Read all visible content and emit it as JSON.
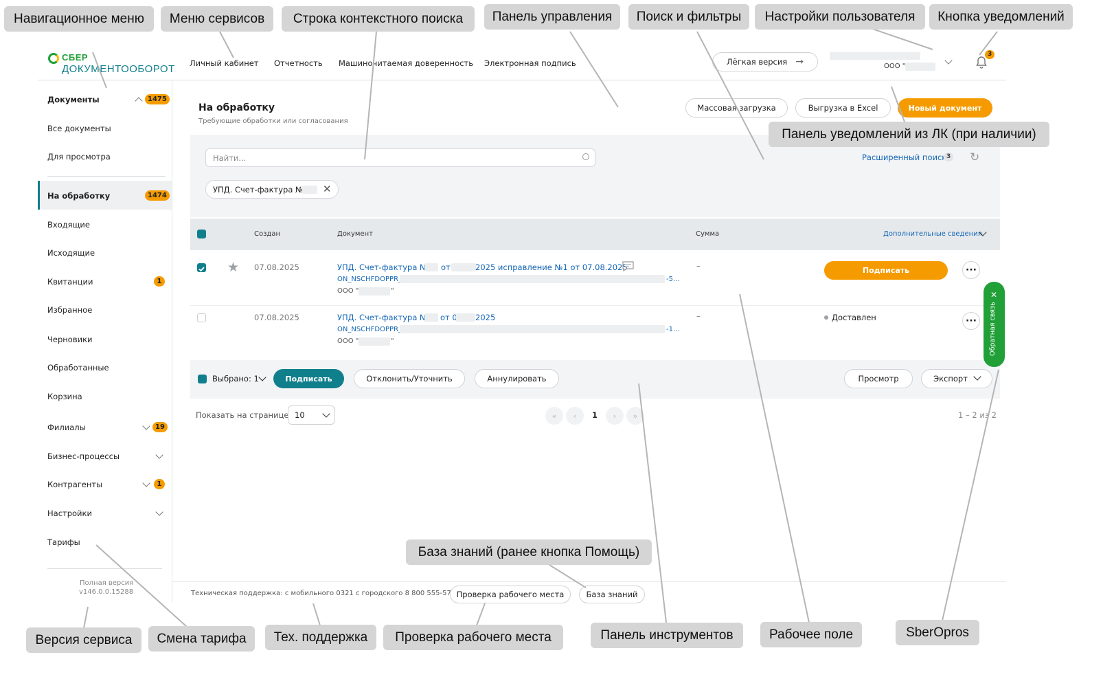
{
  "brand": {
    "line1": "СБЕР",
    "line2": "ДОКУМЕНТООБОРОТ"
  },
  "topnav": {
    "items": [
      "Личный кабинет",
      "Отчетность",
      "Машиночитаемая доверенность",
      "Электронная подпись"
    ],
    "light_version": "Лёгкая версия",
    "org": "ООО \"",
    "bell_count": "3"
  },
  "sidebar": {
    "documents": "Документы",
    "documents_count": "1475",
    "all_docs": "Все документы",
    "for_view": "Для просмотра",
    "in_process": "На обработку",
    "in_process_count": "1474",
    "incoming": "Входящие",
    "outgoing": "Исходящие",
    "receipts": "Квитанции",
    "receipts_count": "1",
    "favorites": "Избранное",
    "drafts": "Черновики",
    "processed": "Обработанные",
    "trash": "Корзина",
    "branches": "Филиалы",
    "branches_count": "19",
    "business": "Бизнес-процессы",
    "contractors": "Контрагенты",
    "contractors_count": "1",
    "settings": "Настройки",
    "tariffs": "Тарифы",
    "version_label": "Полная версия",
    "version": "v146.0.0.15288"
  },
  "main": {
    "title": "На обработку",
    "subtitle": "Требующие обработки или согласования",
    "mass_upload": "Массовая загрузка",
    "excel": "Выгрузка в Excel",
    "new_doc": "Новый документ",
    "search_placeholder": "Найти...",
    "advanced_search": "Расширенный поиск",
    "advanced_count": "3",
    "filter_chip": "УПД. Счет-фактура №",
    "columns": {
      "created": "Создан",
      "document": "Документ",
      "sum": "Сумма",
      "extra": "Дополнительные сведения"
    },
    "rows": [
      {
        "date": "07.08.2025",
        "title_a": "УПД. Счет-фактура №",
        "title_b": "от",
        "title_c": "2025 исправление №1 от 07.08.2025",
        "file_a": "ON_NSCHFDOPPR_",
        "file_b": "-5...",
        "org": "ООО \"",
        "org_end": "\"",
        "sum": "–",
        "action": "Подписать"
      },
      {
        "date": "07.08.2025",
        "title_a": "УПД. Счет-фактура №",
        "title_b": "от 0",
        "title_c": "2025",
        "file_a": "ON_NSCHFDOPPR_",
        "file_b": "-1...",
        "org": "ООО \"",
        "org_end": "\"",
        "sum": "–",
        "status": "Доставлен"
      }
    ],
    "selected": "Выбрано: 1",
    "sign": "Подписать",
    "reject": "Отклонить/Уточнить",
    "annul": "Аннулировать",
    "view": "Просмотр",
    "export": "Экспорт",
    "per_page_label": "Показать на странице:",
    "per_page": "10",
    "page": "1",
    "range": "1 – 2 из 2",
    "feedback": "Обратная связь"
  },
  "footer": {
    "support": "Техническая поддержка: с мобильного 0321 с городского 8 800 555-57-77",
    "check": "Проверка рабочего места",
    "kb": "База знаний"
  },
  "callouts": {
    "nav": "Навигационное меню",
    "services": "Меню сервисов",
    "ctx_search": "Строка контекстного поиска",
    "control": "Панель управления",
    "filters": "Поиск и фильтры",
    "user": "Настройки пользователя",
    "notify_btn": "Кнопка уведомлений",
    "notify_panel": "Панель уведомлений  из ЛК (при наличии)",
    "kb": "База знаний (ранее кнопка Помощь)",
    "version": "Версия сервиса",
    "tariff": "Смена тарифа",
    "support": "Тех. поддержка",
    "check": "Проверка рабочего места",
    "tools": "Панель инструментов",
    "work": "Рабочее поле",
    "opros": "SberOpros"
  }
}
